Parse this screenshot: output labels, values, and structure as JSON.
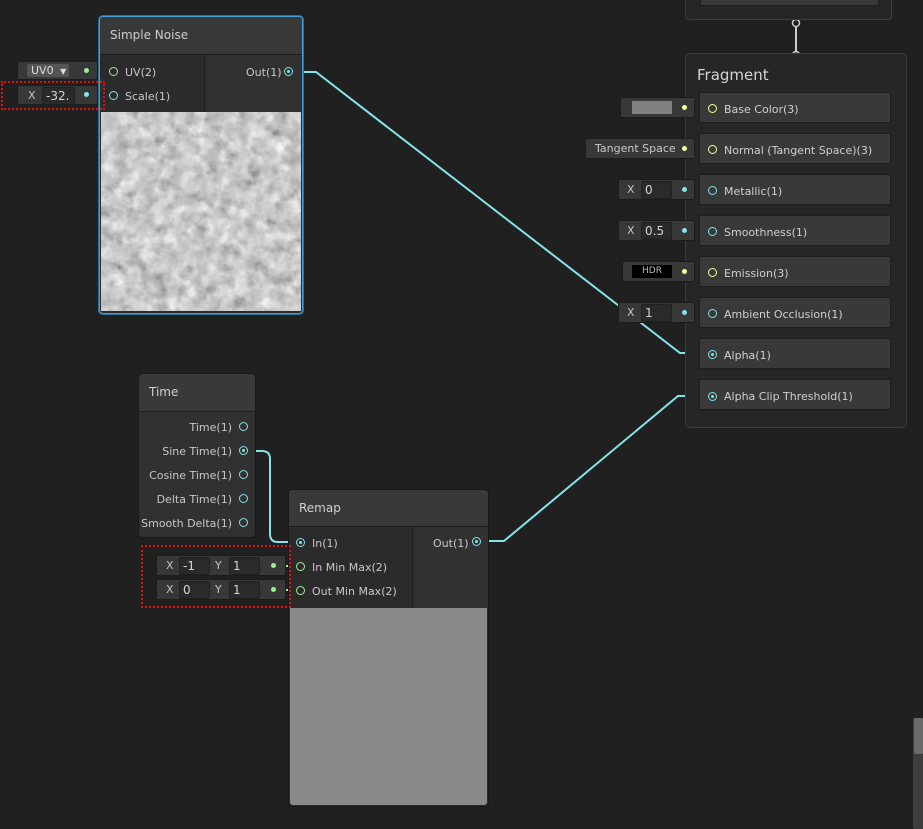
{
  "simple_noise": {
    "title": "Simple Noise",
    "inputs": [
      "UV(2)",
      "Scale(1)"
    ],
    "output": "Out(1)",
    "uv_dropdown": "UV0",
    "scale_axis": "X",
    "scale_value": "-32."
  },
  "time": {
    "title": "Time",
    "outputs": [
      "Time(1)",
      "Sine Time(1)",
      "Cosine Time(1)",
      "Delta Time(1)",
      "Smooth Delta(1)"
    ]
  },
  "remap": {
    "title": "Remap",
    "inputs": [
      "In(1)",
      "In Min Max(2)",
      "Out Min Max(2)"
    ],
    "output": "Out(1)",
    "in_min_max": {
      "x_axis": "X",
      "x": "-1",
      "y_axis": "Y",
      "y": "1"
    },
    "out_min_max": {
      "x_axis": "X",
      "x": "0",
      "y_axis": "Y",
      "y": "1"
    }
  },
  "fragment": {
    "title": "Fragment",
    "ports": [
      "Base Color(3)",
      "Normal (Tangent Space)(3)",
      "Metallic(1)",
      "Smoothness(1)",
      "Emission(3)",
      "Ambient Occlusion(1)",
      "Alpha(1)",
      "Alpha Clip Threshold(1)"
    ],
    "base_color_swatch": "#808080",
    "normal_space": "Tangent Space",
    "metallic": {
      "axis": "X",
      "value": "0"
    },
    "smoothness": {
      "axis": "X",
      "value": "0.5"
    },
    "emission_hdr": "HDR",
    "ambient_occlusion": {
      "axis": "X",
      "value": "1"
    }
  },
  "colors": {
    "wire_float": "#84e4e7",
    "wire_vector2": "#9aef92",
    "wire_vector3": "#f6ff9a",
    "selection": "#44a0d8",
    "highlight_box": "#e01010"
  }
}
